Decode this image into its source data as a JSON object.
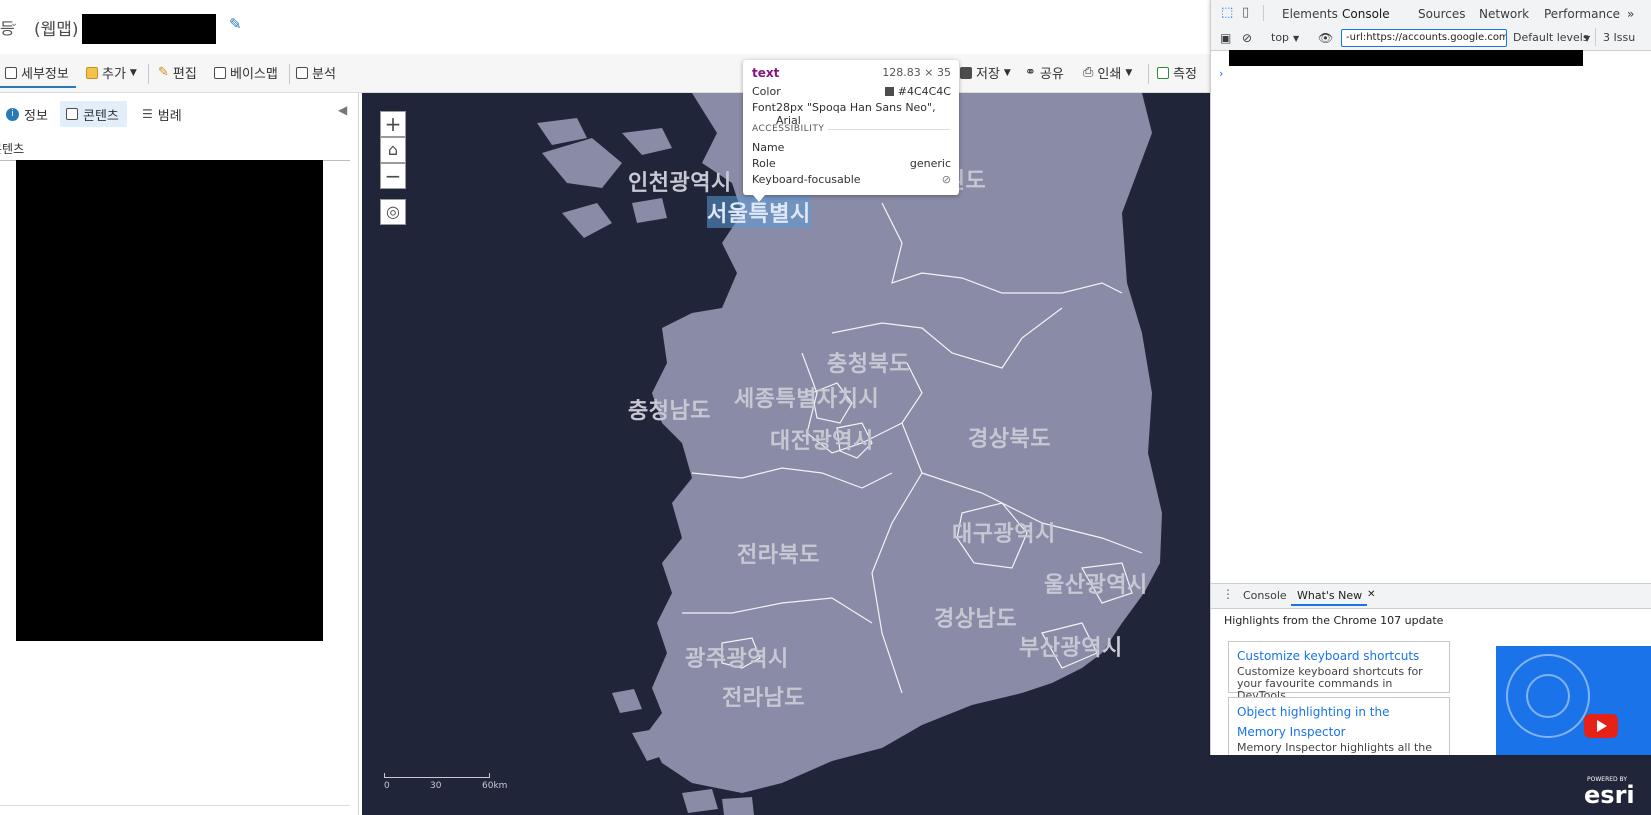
{
  "header": {
    "left_fragment": "등",
    "app_type": "(웹맵)"
  },
  "toolbar": {
    "details": "세부정보",
    "add": "추가",
    "edit": "편집",
    "basemap": "베이스맵",
    "analysis": "분석",
    "save": "저장",
    "share": "공유",
    "print": "인쇄",
    "measure": "측정"
  },
  "left_panel": {
    "tabs": [
      {
        "label": "정보"
      },
      {
        "label": "콘텐츠"
      },
      {
        "label": "범례"
      }
    ],
    "section_title": "콘텐츠"
  },
  "map": {
    "regions": [
      {
        "name": "인천광역시"
      },
      {
        "name": "서울특별시"
      },
      {
        "name": "강원도"
      },
      {
        "name": "충청북도"
      },
      {
        "name": "충청남도"
      },
      {
        "name": "세종특별자치시"
      },
      {
        "name": "대전광역시"
      },
      {
        "name": "경상북도"
      },
      {
        "name": "대구광역시"
      },
      {
        "name": "전라북도"
      },
      {
        "name": "울산광역시"
      },
      {
        "name": "경상남도"
      },
      {
        "name": "부산광역시"
      },
      {
        "name": "광주광역시"
      },
      {
        "name": "전라남도"
      }
    ],
    "scale": {
      "ticks": [
        "0",
        "30",
        "60km"
      ]
    },
    "attribution_small": "POWERED BY",
    "attribution_logo": "esri",
    "colors": {
      "land": "#8a8ba6",
      "water": "#20253a",
      "label": "#c8c8d4",
      "highlight": "#5b9bd5"
    }
  },
  "tooltip": {
    "tag": "text",
    "size": "128.83 × 35",
    "color_label": "Color",
    "color_value": "#4C4C4C",
    "font_label": "Font",
    "font_value": "28px \"Spoqa Han Sans Neo\", Arial",
    "accessibility_heading": "ACCESSIBILITY",
    "name_label": "Name",
    "role_label": "Role",
    "role_value": "generic",
    "focusable_label": "Keyboard-focusable"
  },
  "devtools": {
    "tabs": [
      "Elements",
      "Console",
      "Sources",
      "Network",
      "Performance"
    ],
    "more": "»",
    "context": "top",
    "filter_value": "-url:https://accounts.google.com/",
    "levels": "Default levels",
    "issues": "3 Issu",
    "drawer_tabs": [
      "Console",
      "What's New"
    ],
    "drawer_heading": "Highlights from the Chrome 107 update",
    "cards": [
      {
        "title": "Customize keyboard shortcuts",
        "desc": "Customize keyboard shortcuts for your favourite commands in DevTools."
      },
      {
        "title": "Object highlighting in the Memory Inspector",
        "desc": "Memory Inspector highlights all the bytes"
      }
    ]
  }
}
